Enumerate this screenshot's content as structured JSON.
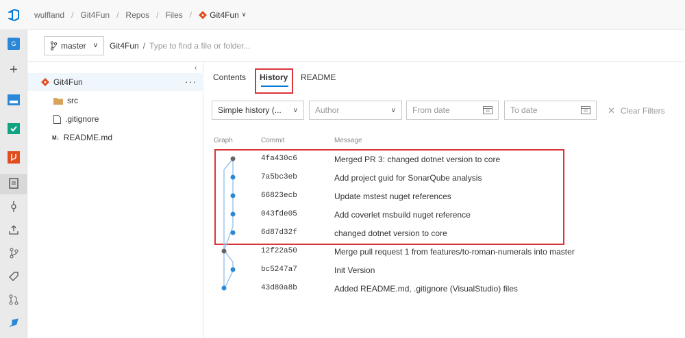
{
  "breadcrumb": {
    "org": "wulfland",
    "project": "Git4Fun",
    "section": "Repos",
    "page": "Files",
    "repo": "Git4Fun"
  },
  "branch_bar": {
    "branch": "master",
    "path_root": "Git4Fun",
    "path_separator": "/",
    "path_placeholder": "Type to find a file or folder..."
  },
  "tree": {
    "root": "Git4Fun",
    "more": "···",
    "items": [
      {
        "label": "src",
        "icon": "folder-icon"
      },
      {
        "label": ".gitignore",
        "icon": "file-icon"
      },
      {
        "label": "README.md",
        "icon": "markdown-icon"
      }
    ]
  },
  "tabs": [
    {
      "label": "Contents"
    },
    {
      "label": "History",
      "active": true
    },
    {
      "label": "README"
    }
  ],
  "filters": {
    "history_mode": "Simple history (...",
    "author_placeholder": "Author",
    "from_date_placeholder": "From date",
    "to_date_placeholder": "To date",
    "clear_label": "Clear Filters"
  },
  "columns": {
    "graph": "Graph",
    "commit": "Commit",
    "message": "Message"
  },
  "commits": [
    {
      "hash": "4fa430c6",
      "message": "Merged PR 3: changed dotnet version to core"
    },
    {
      "hash": "7a5bc3eb",
      "message": "Add project guid for SonarQube analysis"
    },
    {
      "hash": "66823ecb",
      "message": "Update mstest nuget references"
    },
    {
      "hash": "043fde05",
      "message": "Add coverlet msbuild nuget reference"
    },
    {
      "hash": "6d87d32f",
      "message": "changed dotnet version to core"
    },
    {
      "hash": "12f22a50",
      "message": "Merge pull request 1 from features/to-roman-numerals into master"
    },
    {
      "hash": "bc5247a7",
      "message": "Init Version"
    },
    {
      "hash": "43d80a8b",
      "message": "Added README.md, .gitignore (VisualStudio) files"
    }
  ],
  "colors": {
    "accent": "#0078d4",
    "highlight": "#d9343a",
    "git": "#e04e1f",
    "graph_blue": "#2b88d8",
    "graph_gray": "#666666"
  }
}
